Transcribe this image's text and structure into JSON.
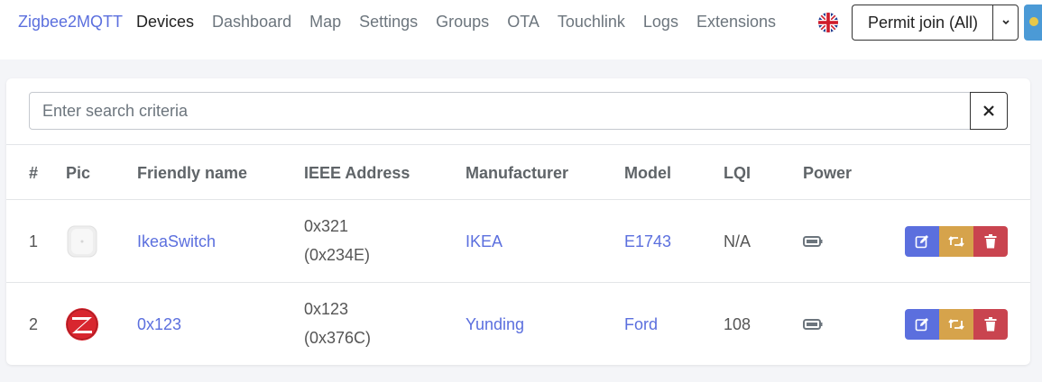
{
  "nav": {
    "brand": "Zigbee2MQTT",
    "links": [
      "Devices",
      "Dashboard",
      "Map",
      "Settings",
      "Groups",
      "OTA",
      "Touchlink",
      "Logs",
      "Extensions"
    ],
    "language_icon": "uk-flag-icon",
    "permit_join_label": "Permit join (All)"
  },
  "search": {
    "placeholder": "Enter search criteria",
    "value": ""
  },
  "table": {
    "headers": [
      "#",
      "Pic",
      "Friendly name",
      "IEEE Address",
      "Manufacturer",
      "Model",
      "LQI",
      "Power"
    ],
    "rows": [
      {
        "index": "1",
        "pic": "ikea-switch-image",
        "friendly_name": "IkeaSwitch",
        "ieee_line1": "0x321",
        "ieee_line2": "(0x234E)",
        "manufacturer": "IKEA",
        "model": "E1743",
        "lqi": "N/A",
        "power_icon": "battery-icon"
      },
      {
        "index": "2",
        "pic": "zigbee-logo-image",
        "friendly_name": "0x123",
        "ieee_line1": "0x123",
        "ieee_line2": "(0x376C)",
        "manufacturer": "Yunding",
        "model": "Ford",
        "lqi": "108",
        "power_icon": "battery-icon"
      }
    ]
  },
  "colors": {
    "primary": "#5b6fde",
    "warning": "#d6a34b",
    "danger": "#c9444f"
  }
}
